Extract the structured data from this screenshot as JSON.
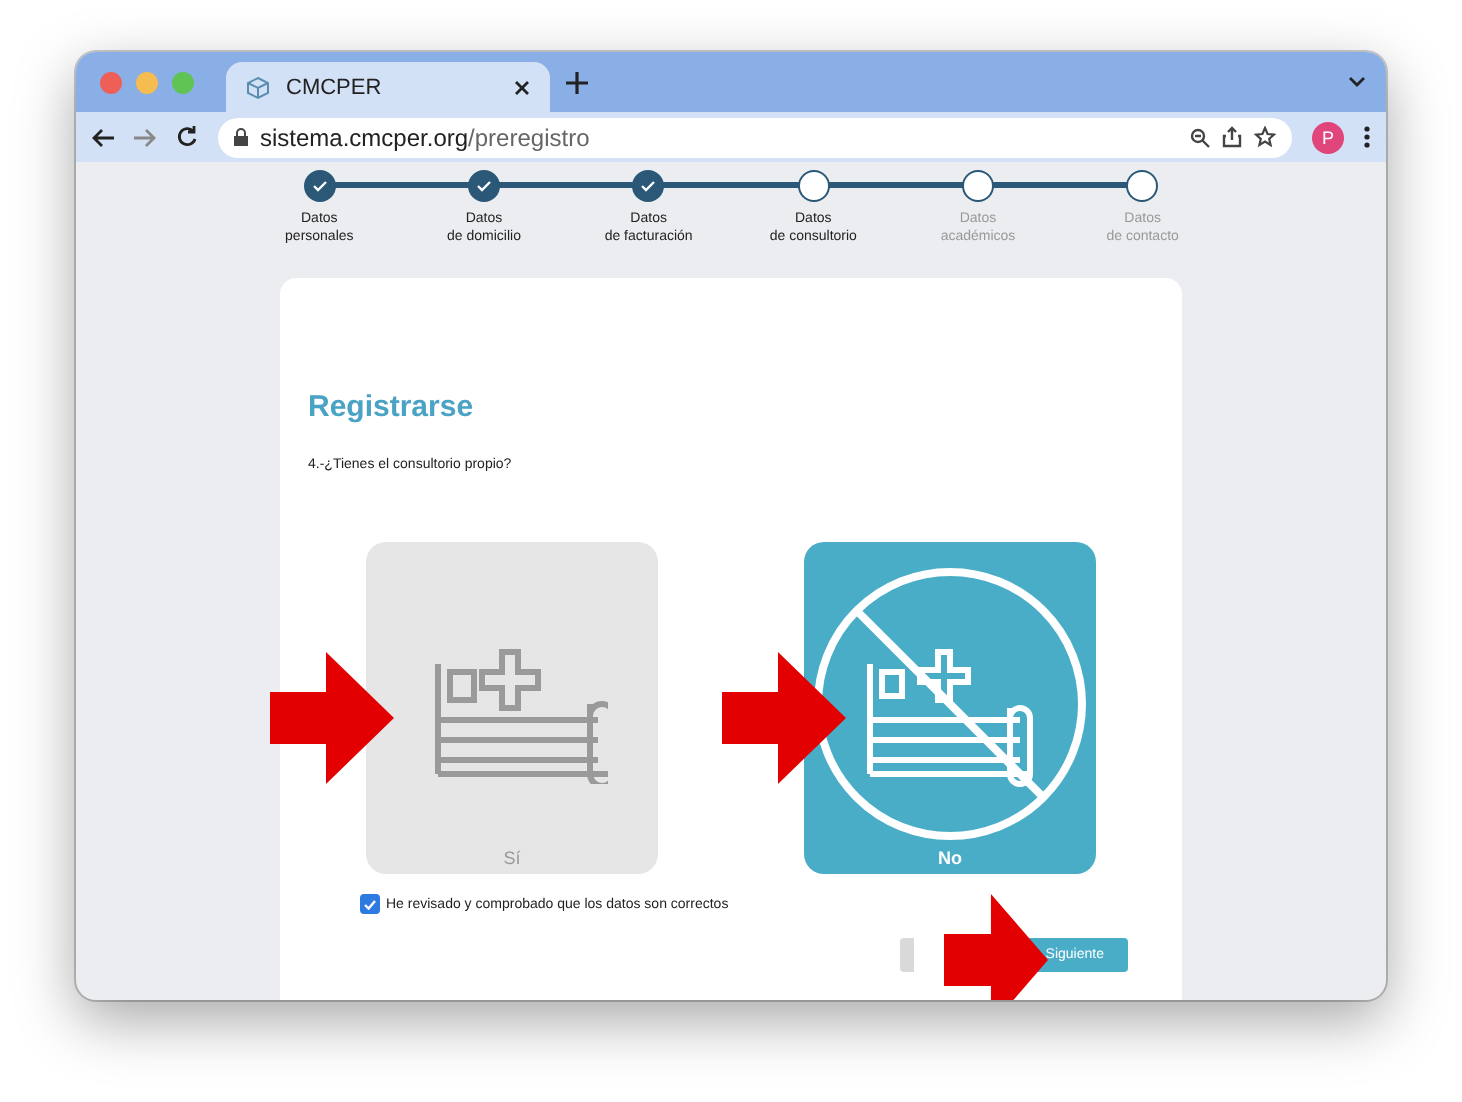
{
  "browser": {
    "tab_title": "CMCPER",
    "url_host": "sistema.cmcper.org",
    "url_path": "/preregistro",
    "profile_initial": "P"
  },
  "steps": [
    {
      "label": "Datos\npersonales",
      "kind": "done",
      "disabled": false
    },
    {
      "label": "Datos\nde domicilio",
      "kind": "done",
      "disabled": false
    },
    {
      "label": "Datos\nde facturación",
      "kind": "done",
      "disabled": false
    },
    {
      "label": "Datos\nde consultorio",
      "kind": "pending",
      "disabled": false
    },
    {
      "label": "Datos\nacadémicos",
      "kind": "pending",
      "disabled": true
    },
    {
      "label": "Datos\nde contacto",
      "kind": "pending",
      "disabled": true
    }
  ],
  "form": {
    "title": "Registrarse",
    "question": "4.-¿Tienes el consultorio propio?",
    "options": [
      {
        "label": "Sí",
        "kind": "yes",
        "selected": false
      },
      {
        "label": "No",
        "kind": "no",
        "selected": true
      }
    ],
    "confirm": {
      "label": "He revisado y comprobado que los datos son correctos",
      "checked": true
    },
    "next_button": "Siguiente"
  }
}
